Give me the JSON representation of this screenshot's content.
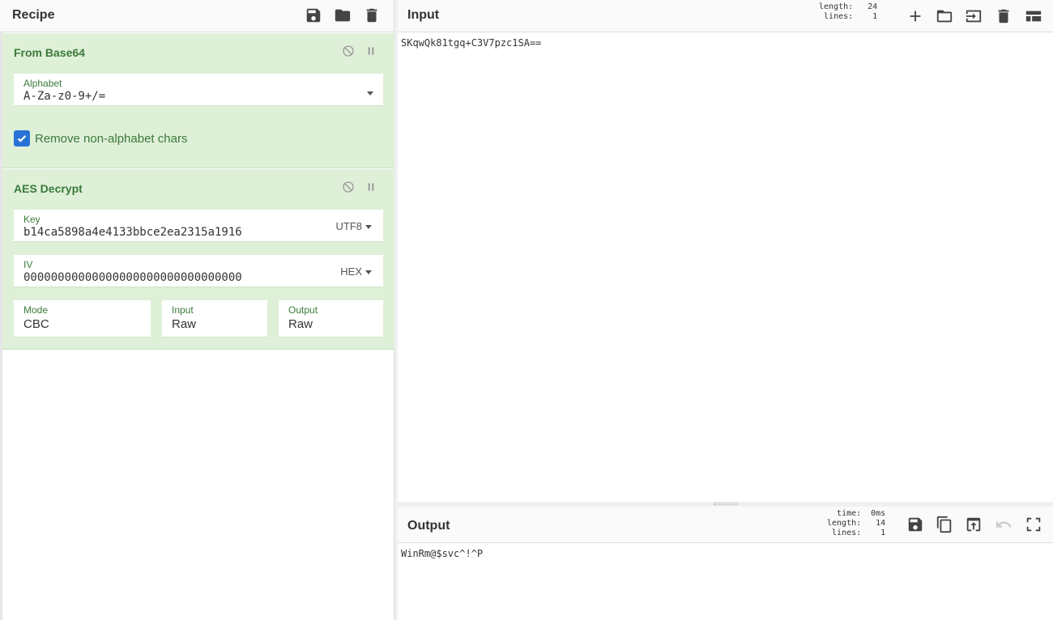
{
  "recipe": {
    "title": "Recipe",
    "icons": [
      "save-icon",
      "folder-icon",
      "trash-icon"
    ],
    "operations": [
      {
        "title": "From Base64",
        "alphabet_label": "Alphabet",
        "alphabet_value": "A-Za-z0-9+/=",
        "remove_label": "Remove non-alphabet chars",
        "remove_checked": true
      },
      {
        "title": "AES Decrypt",
        "key_label": "Key",
        "key_value": "b14ca5898a4e4133bbce2ea2315a1916",
        "key_format": "UTF8",
        "iv_label": "IV",
        "iv_value": "00000000000000000000000000000000",
        "iv_format": "HEX",
        "mode_label": "Mode",
        "mode_value": "CBC",
        "input_label": "Input",
        "input_value": "Raw",
        "output_label": "Output",
        "output_value": "Raw"
      }
    ]
  },
  "input": {
    "title": "Input",
    "length_label": "length:",
    "length_value": "24",
    "lines_label": "lines:",
    "lines_value": "1",
    "text": "SKqwQk81tgq+C3V7pzc1SA=="
  },
  "output": {
    "title": "Output",
    "time_label": "time:",
    "time_value": "0ms",
    "length_label": "length:",
    "length_value": "14",
    "lines_label": "lines:",
    "lines_value": "1",
    "text": "WinRm@$svc^!^P"
  },
  "colors": {
    "op_background": "#dff0d8",
    "op_title": "#3a7a3a",
    "checkbox": "#2a73d6"
  }
}
